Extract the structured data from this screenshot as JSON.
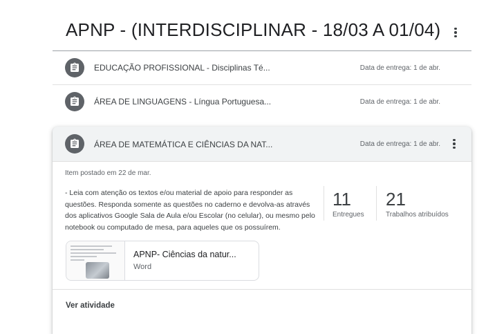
{
  "topic": {
    "title": "APNP - (INTERDISCIPLINAR - 18/03 A 01/04)"
  },
  "assignments": [
    {
      "title": "EDUCAÇÃO PROFISSIONAL - Disciplinas Té...",
      "due": "Data de entrega: 1 de abr."
    },
    {
      "title": "ÁREA DE LINGUAGENS - Língua Portuguesa...",
      "due": "Data de entrega: 1 de abr."
    },
    {
      "title": "ÁREA DE MATEMÁTICA E CIÊNCIAS DA NAT...",
      "due": "Data de entrega: 1 de abr.",
      "posted": "Item postado em 22 de mar.",
      "instructions": "- Leia com atenção os textos e/ou material de apoio para responder as questões. Responda somente as questões no caderno e devolva-as através dos aplicativos Google Sala de Aula e/ou Escolar (no celular), ou mesmo pelo notebook ou computado de mesa, para aqueles que os possuírem.",
      "stats": {
        "turned_in": {
          "value": "11",
          "label": "Entregues"
        },
        "assigned": {
          "value": "21",
          "label": "Trabalhos atribuídos"
        }
      },
      "attachment": {
        "title": "APNP- Ciências da natur...",
        "type": "Word"
      },
      "view_link": "Ver atividade"
    }
  ],
  "icons": {
    "assignment": "assignment-icon",
    "more": "more-vert-icon"
  },
  "colors": {
    "icon_bg": "#5f6368",
    "header_bg": "#f1f3f4"
  }
}
